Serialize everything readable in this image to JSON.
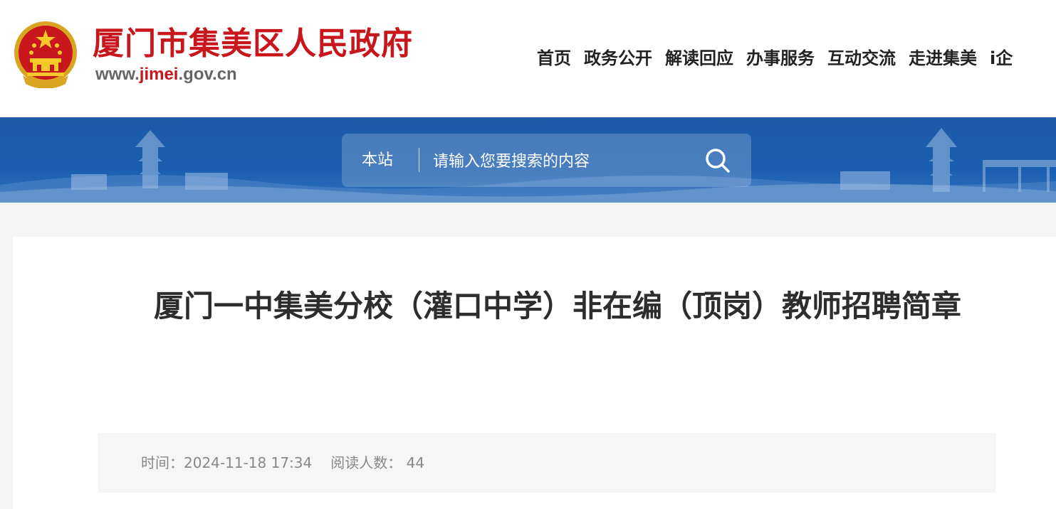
{
  "header": {
    "site_name": "厦门市集美区人民政府",
    "url_prefix": "www.",
    "url_highlight": "jimei",
    "url_suffix": ".gov.cn",
    "emblem_icon": "national-emblem-icon",
    "brand_color": "#c8161d"
  },
  "nav": {
    "items": [
      "首页",
      "政务公开",
      "解读回应",
      "办事服务",
      "互动交流",
      "走进集美",
      "i企"
    ]
  },
  "search": {
    "scope_label": "本站",
    "placeholder": "请输入您要搜索的内容",
    "button_icon": "search-icon",
    "banner_color": "#1b5eb0"
  },
  "article": {
    "title": "厦门一中集美分校（灌口中学）非在编（顶岗）教师招聘简章",
    "time_label": "时间：",
    "time_value": "2024-11-18 17:34",
    "reads_label": "阅读人数：",
    "reads_value": "44"
  }
}
